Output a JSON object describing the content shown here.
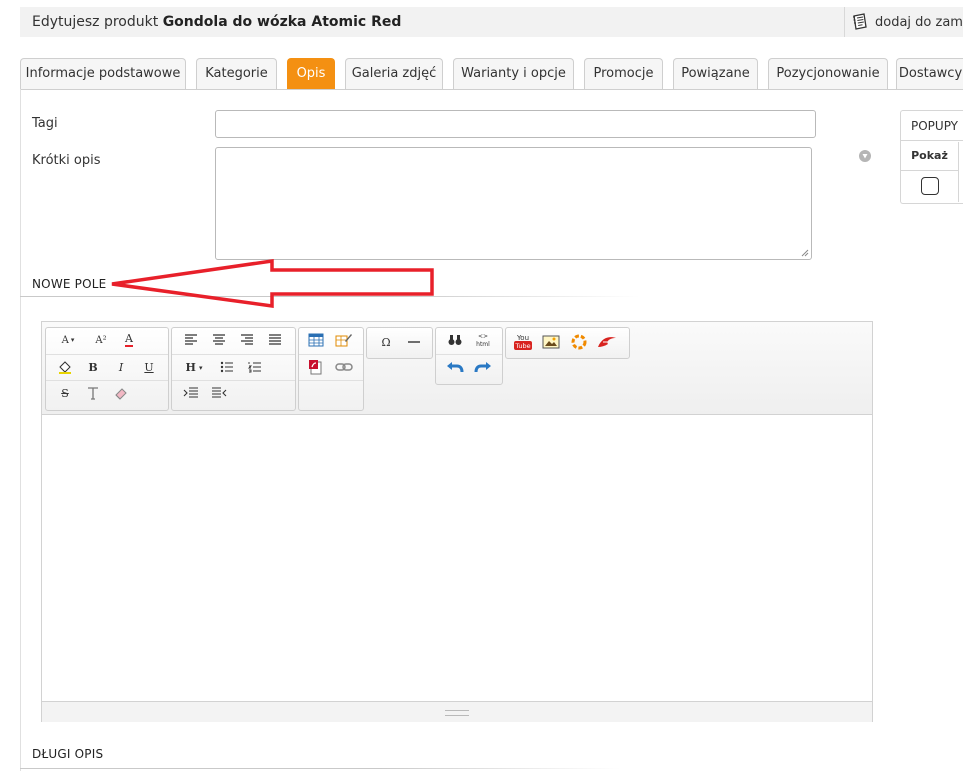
{
  "header": {
    "title_prefix": "Edytujesz produkt ",
    "product_name": "Gondola do wózka Atomic Red",
    "add_to_order": "dodaj do zamó"
  },
  "tabs": [
    {
      "label": "Informacje podstawowe",
      "active": false
    },
    {
      "label": "Kategorie",
      "active": false
    },
    {
      "label": "Opis",
      "active": true
    },
    {
      "label": "Galeria zdjęć",
      "active": false
    },
    {
      "label": "Warianty i opcje",
      "active": false
    },
    {
      "label": "Promocje",
      "active": false
    },
    {
      "label": "Powiązane",
      "active": false
    },
    {
      "label": "Pozycjonowanie",
      "active": false
    },
    {
      "label": "Dostawcy",
      "active": false
    }
  ],
  "form": {
    "tags_label": "Tagi",
    "tags_value": "",
    "short_desc_label": "Krótki opis",
    "short_desc_value": ""
  },
  "popups": {
    "header": "POPUPY",
    "column_show": "Pokaż",
    "show_checked": false
  },
  "sections": {
    "new_field": "NOWE POLE",
    "long_desc": "DŁUGI OPIS"
  },
  "colors": {
    "accent": "#f49012",
    "arrow": "#e8202a"
  },
  "editor": {
    "format_label": "H",
    "font_size_label": "A",
    "superscript_label": "A²",
    "bold": "B",
    "italic": "I",
    "underline": "U",
    "strike": "S",
    "special_char": "Ω",
    "youtube_label": "You"
  }
}
